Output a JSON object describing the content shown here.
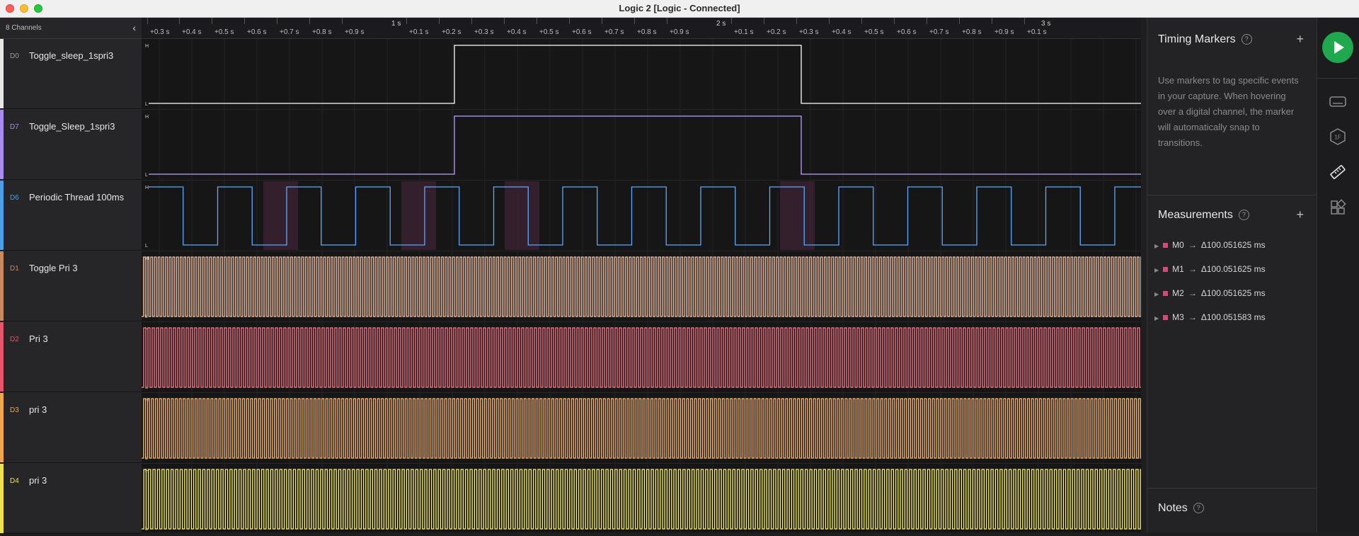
{
  "window": {
    "title": "Logic 2 [Logic - Connected]"
  },
  "sidebar": {
    "channel_count": "8 Channels"
  },
  "channels": [
    {
      "id": "D0",
      "name": "Toggle_sleep_1spri3",
      "color": "#e8e8e8",
      "id_color": "#9a9a9a"
    },
    {
      "id": "D7",
      "name": "Toggle_Sleep_1spri3",
      "color": "#a98cf0",
      "id_color": "#a98cf0"
    },
    {
      "id": "D6",
      "name": "Periodic Thread 100ms",
      "color": "#4a9fe8",
      "id_color": "#4a9fe8"
    },
    {
      "id": "D1",
      "name": "Toggle Pri 3",
      "color": "#c98a62",
      "id_color": "#c98a62"
    },
    {
      "id": "D2",
      "name": "Pri 3",
      "color": "#e8546a",
      "id_color": "#e8546a"
    },
    {
      "id": "D3",
      "name": "pri 3",
      "color": "#f2a64a",
      "id_color": "#f2a64a"
    },
    {
      "id": "D4",
      "name": "pri 3",
      "color": "#f0e04a",
      "id_color": "#f0e04a"
    }
  ],
  "wave_colors": [
    "#ffffff",
    "#b9a2ff",
    "#5aa8ff",
    "#f5c6a8",
    "#ff7d8c",
    "#ffbe6e",
    "#fff25a"
  ],
  "level_labels": {
    "high": "H",
    "low": "L"
  },
  "ruler": {
    "ticks": [
      "+0.3 s",
      "+0.4 s",
      "+0.5 s",
      "+0.6 s",
      "+0.7 s",
      "+0.8 s",
      "+0.9 s",
      "+0.1 s",
      "+0.2 s",
      "+0.3 s",
      "+0.4 s",
      "+0.5 s",
      "+0.6 s",
      "+0.7 s",
      "+0.8 s",
      "+0.9 s",
      "+0.1 s",
      "+0.2 s",
      "+0.3 s",
      "+0.4 s",
      "+0.5 s",
      "+0.6 s",
      "+0.7 s",
      "+0.8 s",
      "+0.9 s",
      "+0.1 s"
    ],
    "majors": [
      "1 s",
      "2 s",
      "3 s"
    ]
  },
  "timing_markers": {
    "title": "Timing Markers",
    "help": "?",
    "add": "+",
    "description": "Use markers to tag specific events in your capture. When hovering over a digital channel, the marker will automatically snap to transitions."
  },
  "measurements": {
    "title": "Measurements",
    "help": "?",
    "add": "+",
    "items": [
      {
        "name": "M0",
        "delta": "Δ100.051625 ms"
      },
      {
        "name": "M1",
        "delta": "Δ100.051625 ms"
      },
      {
        "name": "M2",
        "delta": "Δ100.051625 ms"
      },
      {
        "name": "M3",
        "delta": "Δ100.051583 ms"
      }
    ],
    "color": "#e2417a"
  },
  "notes": {
    "title": "Notes",
    "help": "?"
  },
  "toolbar": {
    "start_color": "#1fa84e",
    "tools": [
      "keyboard-icon",
      "hex-analyzer-icon",
      "ruler-icon",
      "extensions-icon"
    ]
  }
}
